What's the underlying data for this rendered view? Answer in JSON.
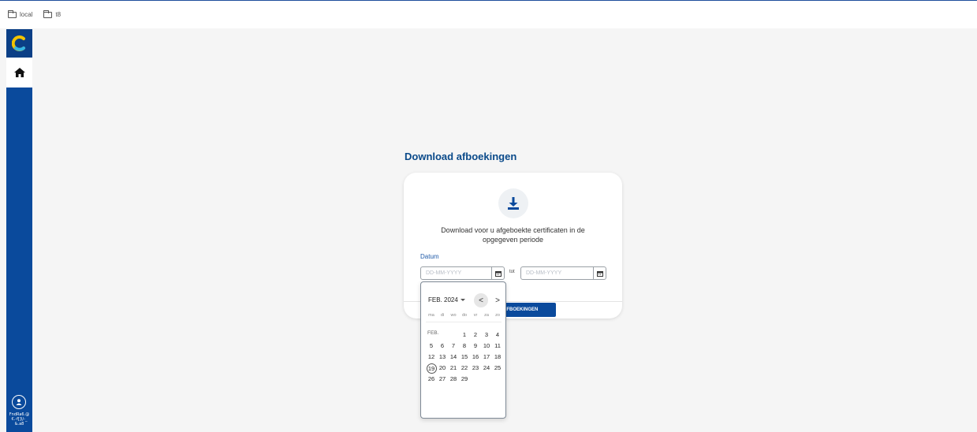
{
  "bookmarks": [
    {
      "label": "local",
      "icon": "folder-icon"
    },
    {
      "label": "t8",
      "icon": "folder-icon"
    }
  ],
  "sidebar": {
    "logo_icon": "c-logo-icon",
    "home_icon": "home-icon",
    "user_icon": "user-icon",
    "user_text": "FndRa6.@ €.-f[]\\/-_ &.a8"
  },
  "main": {
    "title": "Download afboekingen",
    "description": "Download voor u afgeboekte certificaten in de opgegeven periode",
    "date_label": "Datum",
    "from_placeholder": "DD-MM-YYYY",
    "to_placeholder": "DD-MM-YYYY",
    "tot_label": "tot",
    "submit_label": "AFBOEKINGEN"
  },
  "datepicker": {
    "month_year": "FEB. 2024",
    "prev_symbol": "<",
    "next_symbol": ">",
    "weekdays": [
      "ma",
      "di",
      "wo",
      "do",
      "vr",
      "za",
      "zo"
    ],
    "month_short": "FEB.",
    "today": "19",
    "rows": [
      [
        "",
        "",
        "",
        "1",
        "2",
        "3",
        "4"
      ],
      [
        "5",
        "6",
        "7",
        "8",
        "9",
        "10",
        "11"
      ],
      [
        "12",
        "13",
        "14",
        "15",
        "16",
        "17",
        "18"
      ],
      [
        "19",
        "20",
        "21",
        "22",
        "23",
        "24",
        "25"
      ],
      [
        "26",
        "27",
        "28",
        "29",
        "",
        "",
        ""
      ]
    ]
  },
  "colors": {
    "sidebar": "#0a4a9c",
    "title": "#0a4a8a",
    "button": "#0a4a9c"
  }
}
